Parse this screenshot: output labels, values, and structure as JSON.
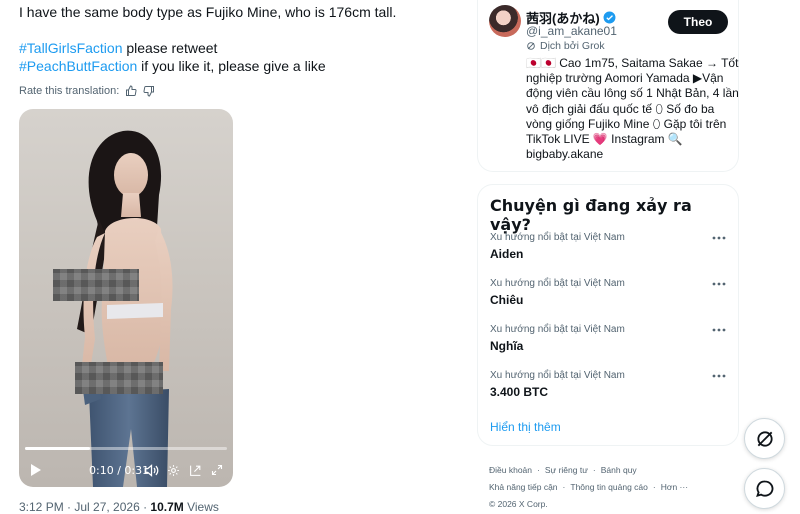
{
  "post": {
    "text_line1": "I have the same body type as Fujiko Mine, who is 176cm tall.",
    "hashtag1": "#TallGirlsFaction",
    "text_line2_rest": " please retweet",
    "hashtag2": "#PeachButtFaction",
    "text_line3_rest": " if you like it, please give a like",
    "rate_label": "Rate this translation:",
    "video": {
      "time": "0:10 / 0:31",
      "progress": 0.32
    },
    "timestamp": "3:12 PM · Jul 27, 2026 · ",
    "views_count": "10.7M",
    "views_label": " Views"
  },
  "profile": {
    "name": "茜羽(あかね)",
    "handle": "@i_am_akane01",
    "follow_label": "Theo",
    "grok_label": "Dịch bởi Grok",
    "bio_lines": [
      "🇯🇵🇯🇵 Cao 1m75, Saitama Sakae → Tốt",
      "nghiệp trường Aomori Yamada ▶Vận",
      "động viên cầu lông số 1 Nhật Bản, 4 lần",
      "vô địch giải đấu quốc tế ⬯ Số đo ba",
      "vòng giống Fujiko Mine ⬯ Gặp tôi trên",
      "TikTok LIVE 💗 Instagram 🔍",
      "bigbaby.akane"
    ],
    "verified_color": "#1d9bf0"
  },
  "trends": {
    "title": "Chuyện gì đang xảy ra vậy?",
    "items": [
      {
        "context": "Xu hướng nổi bật tại Việt Nam",
        "name": "Aiden"
      },
      {
        "context": "Xu hướng nổi bật tại Việt Nam",
        "name": "Chiêu"
      },
      {
        "context": "Xu hướng nổi bật tại Việt Nam",
        "name": "Nghĩa"
      },
      {
        "context": "Xu hướng nổi bật tại Việt Nam",
        "name": "3.400 BTC"
      }
    ],
    "show_more": "Hiển thị thêm"
  },
  "footer": {
    "links_row1": [
      "Điều khoản",
      "Sự riêng tư",
      "Bánh quy"
    ],
    "links_row2": [
      "Khả năng tiếp cận",
      "Thông tin quảng cáo",
      "Hơn ···"
    ],
    "copyright": "© 2026 X Corp."
  },
  "colors": {
    "accent": "#1d9bf0",
    "text_primary": "#0f1419",
    "text_secondary": "#536471",
    "border": "#eff3f4"
  },
  "icons": [
    "thumbs-up-icon",
    "thumbs-down-icon",
    "play-icon",
    "volume-icon",
    "settings-icon",
    "miniplayer-icon",
    "fullscreen-icon",
    "verified-badge-icon",
    "grok-icon",
    "more-icon",
    "grok-fab-icon",
    "messages-icon"
  ]
}
